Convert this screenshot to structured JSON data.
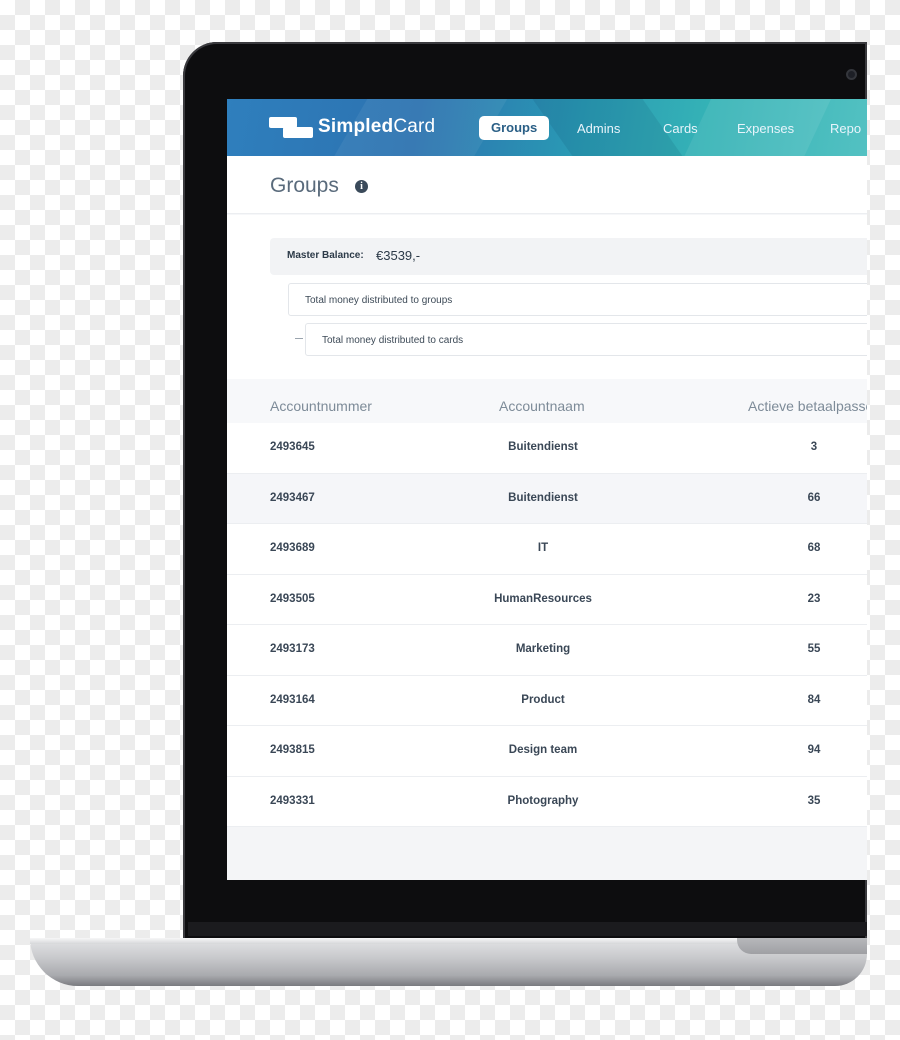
{
  "app": {
    "logo_bold": "Simpled",
    "logo_light": "Card"
  },
  "nav": {
    "items": [
      {
        "label": "Groups",
        "active": true
      },
      {
        "label": "Admins",
        "active": false
      },
      {
        "label": "Cards",
        "active": false
      },
      {
        "label": "Expenses",
        "active": false
      },
      {
        "label": "Repo",
        "active": false
      }
    ]
  },
  "page": {
    "title": "Groups",
    "info_icon": "i"
  },
  "balance": {
    "master_label": "Master Balance:",
    "master_value": "€3539,-",
    "groups_text": "Total money distributed to groups",
    "cards_text": "Total money distributed to cards"
  },
  "table": {
    "headers": [
      "Accountnummer",
      "Accountnaam",
      "Actieve betaalpasse"
    ],
    "rows": [
      [
        "2493645",
        "Buitendienst",
        "3"
      ],
      [
        "2493467",
        "Buitendienst",
        "66"
      ],
      [
        "2493689",
        "IT",
        "68"
      ],
      [
        "2493505",
        "HumanResources",
        "23"
      ],
      [
        "2493173",
        "Marketing",
        "55"
      ],
      [
        "2493164",
        "Product",
        "84"
      ],
      [
        "2493815",
        "Design team",
        "94"
      ],
      [
        "2493331",
        "Photography",
        "35"
      ]
    ]
  },
  "colors": {
    "nav_gradient_start": "#2f7fbd",
    "nav_gradient_end": "#53c1c2",
    "text_dark": "#3a4756",
    "header_text": "#7d8b98"
  }
}
